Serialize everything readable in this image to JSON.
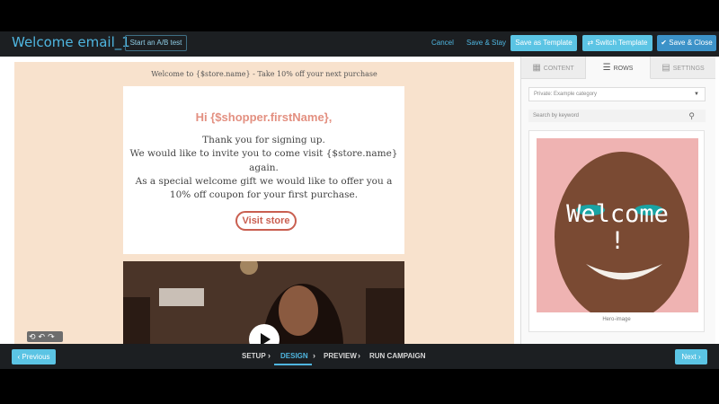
{
  "header": {
    "title": "Welcome email_1",
    "ab_test_label": "Start an A/B test",
    "cancel_label": "Cancel",
    "save_stay_label": "Save & Stay",
    "save_template_label": "Save as Template",
    "switch_template_label": "Switch Template",
    "save_close_label": "Save & Close"
  },
  "email": {
    "preheader": "Welcome to {$store.name} - Take 10% off your next purchase",
    "greeting": "Hi {$shopper.firstName},",
    "body_lines": [
      "Thank you for signing up.",
      "We would like to invite you to come visit {$store.name}",
      "again.",
      "As a special welcome gift we would like to offer you a",
      "10% off coupon for your first purchase."
    ],
    "cta_label": "Visit store"
  },
  "panel": {
    "tabs": [
      {
        "label": "CONTENT",
        "icon": "grid-icon"
      },
      {
        "label": "ROWS",
        "icon": "rows-icon"
      },
      {
        "label": "SETTINGS",
        "icon": "settings-icon"
      }
    ],
    "active_tab": "ROWS",
    "category_placeholder": "Private: Example category",
    "search_placeholder": "Search by keyword",
    "row_preview": {
      "overlay_text_1": "Welcome",
      "overlay_text_2": "!",
      "caption": "Hero-image"
    }
  },
  "footer": {
    "previous_label": "Previous",
    "next_label": "Next",
    "steps": [
      "SETUP",
      "DESIGN",
      "PREVIEW",
      "RUN CAMPAIGN"
    ],
    "active_step": "DESIGN"
  },
  "colors": {
    "accent": "#4fb6e0",
    "button": "#5bc4e4",
    "email_background": "#f8e2cd",
    "greeting": "#e39081",
    "cta": "#c95f50"
  }
}
